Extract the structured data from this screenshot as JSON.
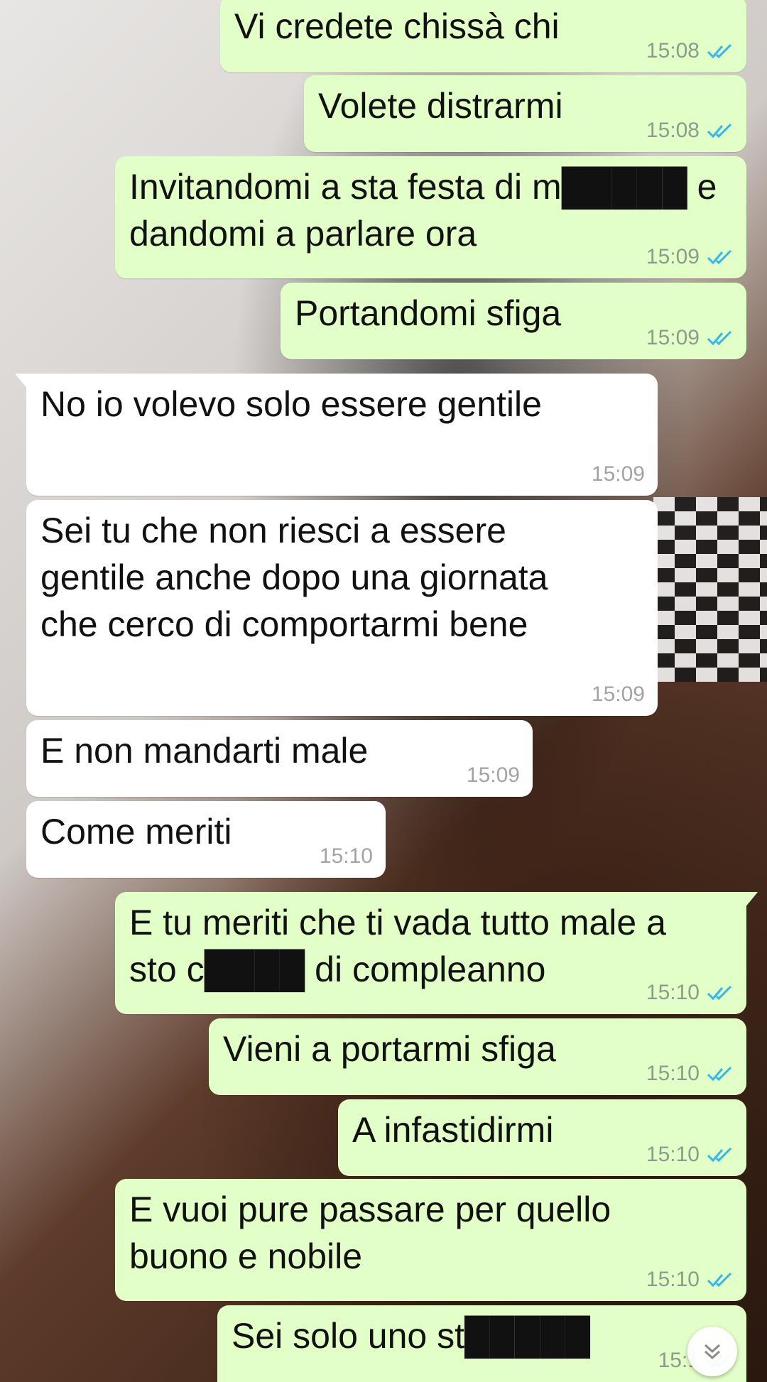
{
  "messages": [
    {
      "text": "Vi credete chissà chi",
      "time": "15:08",
      "status": "read-double-check-icon"
    },
    {
      "text": "Volete distrarmi",
      "time": "15:08",
      "status": "read-double-check-icon"
    },
    {
      "text": "Invitandomi a sta festa di m█████ e\ndandomi a parlare ora",
      "time": "15:09",
      "status": "read-double-check-icon"
    },
    {
      "text": "Portandomi sfiga",
      "time": "15:09",
      "status": "read-double-check-icon"
    },
    {
      "text": "No io volevo solo essere gentile",
      "time": "15:09"
    },
    {
      "text": "Sei tu che non riesci a essere\ngentile anche dopo una giornata\nche cerco di comportarmi bene",
      "time": "15:09"
    },
    {
      "text": "E non mandarti male",
      "time": "15:09"
    },
    {
      "text": "Come meriti",
      "time": "15:10"
    },
    {
      "text": "E tu meriti che ti vada tutto male a\nsto c████ di compleanno",
      "time": "15:10",
      "status": "read-double-check-icon"
    },
    {
      "text": "Vieni a portarmi sfiga",
      "time": "15:10",
      "status": "read-double-check-icon"
    },
    {
      "text": "A infastidirmi",
      "time": "15:10",
      "status": "read-double-check-icon"
    },
    {
      "text": "E vuoi pure passare per quello\nbuono e nobile",
      "time": "15:10",
      "status": "read-double-check-icon"
    },
    {
      "text": "Sei solo uno st█████",
      "time": "15:1",
      "status": "read-double-check-icon"
    }
  ],
  "colors": {
    "outgoing_bubble": "#e1ffc7",
    "incoming_bubble": "#ffffff",
    "read_ticks": "#34b7f1"
  },
  "scroll_button": {
    "icon": "double-chevron-down-icon"
  }
}
